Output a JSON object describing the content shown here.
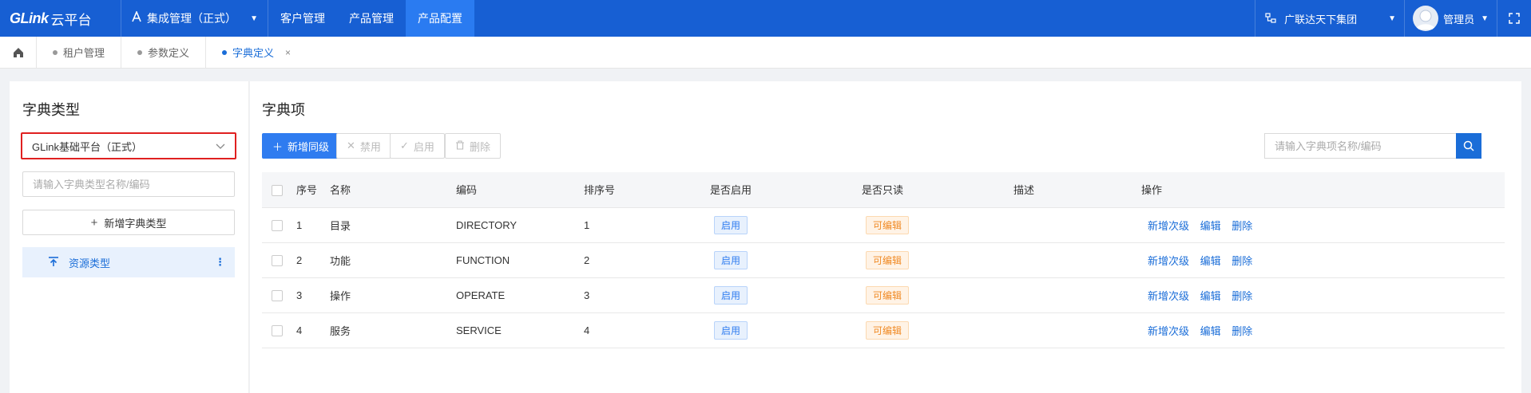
{
  "topbar": {
    "logo_brand": "GLink",
    "logo_suffix": "云平台",
    "system": "集成管理（正式）",
    "nav": [
      "客户管理",
      "产品管理",
      "产品配置"
    ],
    "active_nav": "产品配置",
    "org": "广联达天下集团",
    "user": "管理员"
  },
  "tabs": [
    {
      "label": "租户管理",
      "active": false
    },
    {
      "label": "参数定义",
      "active": false
    },
    {
      "label": "字典定义",
      "active": true
    }
  ],
  "left": {
    "title": "字典类型",
    "platform_select": "GLink基础平台（正式）",
    "search_placeholder": "请输入字典类型名称/编码",
    "add_button": "新增字典类型",
    "tree_items": [
      "资源类型"
    ]
  },
  "right": {
    "title": "字典项",
    "buttons": {
      "add_same_level": "新增同级",
      "disable": "禁用",
      "enable": "启用",
      "delete": "删除"
    },
    "search_placeholder": "请输入字典项名称/编码",
    "columns": [
      "序号",
      "名称",
      "编码",
      "排序号",
      "是否启用",
      "是否只读",
      "描述",
      "操作"
    ],
    "rows": [
      {
        "index": "1",
        "name": "目录",
        "code": "DIRECTORY",
        "sort": "1",
        "enabled": "启用",
        "readonly": "可编辑",
        "desc": ""
      },
      {
        "index": "2",
        "name": "功能",
        "code": "FUNCTION",
        "sort": "2",
        "enabled": "启用",
        "readonly": "可编辑",
        "desc": ""
      },
      {
        "index": "3",
        "name": "操作",
        "code": "OPERATE",
        "sort": "3",
        "enabled": "启用",
        "readonly": "可编辑",
        "desc": ""
      },
      {
        "index": "4",
        "name": "服务",
        "code": "SERVICE",
        "sort": "4",
        "enabled": "启用",
        "readonly": "可编辑",
        "desc": ""
      }
    ],
    "row_actions": [
      "新增次级",
      "编辑",
      "删除"
    ]
  },
  "colors": {
    "topbar": "#175fd3",
    "active_nav": "#2a7bf1",
    "primary": "#2f7cf0",
    "link": "#1a6dd8",
    "highlight_border": "#e02020",
    "warning": "#f08a24"
  }
}
